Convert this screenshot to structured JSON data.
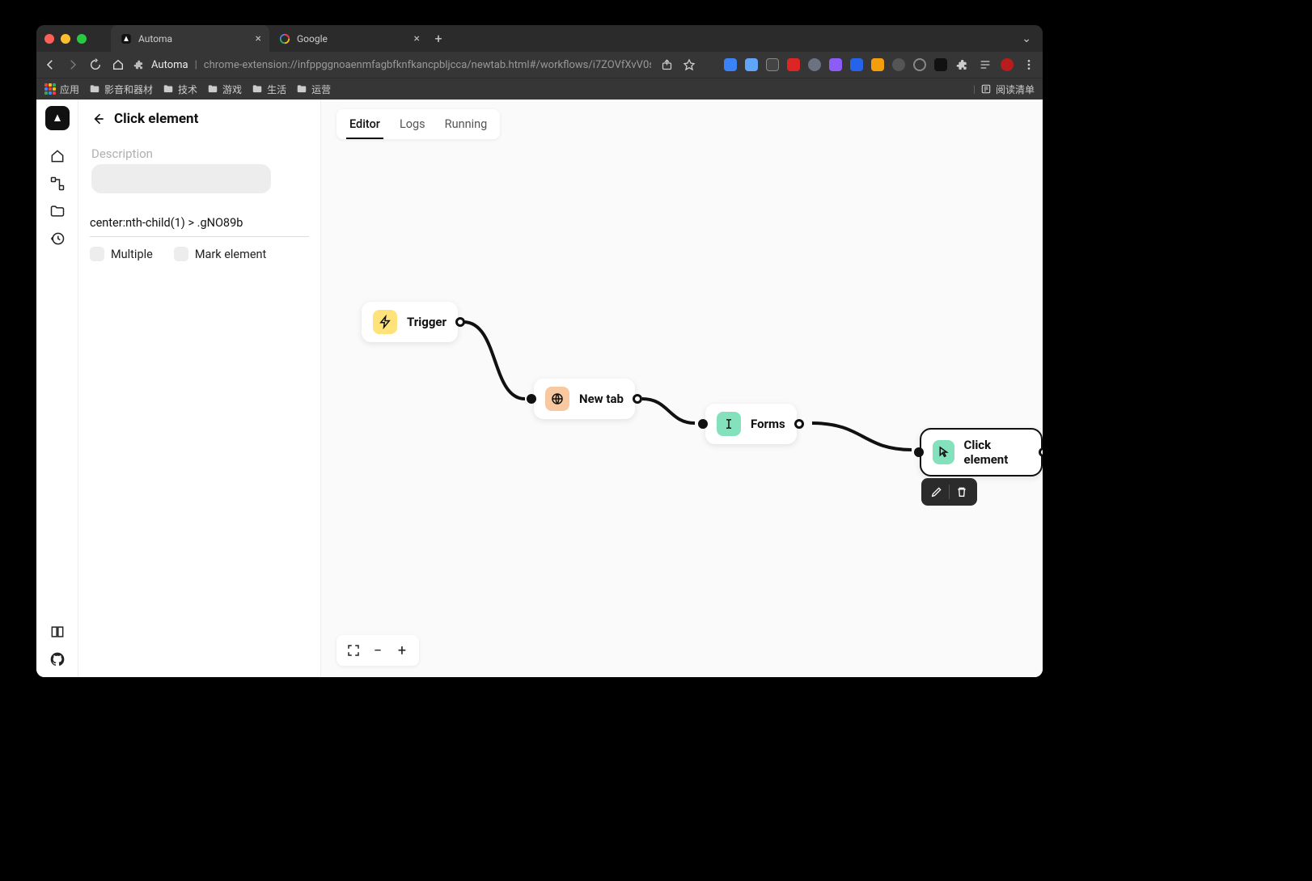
{
  "browser": {
    "tabs": [
      {
        "title": "Automa",
        "active": true
      },
      {
        "title": "Google",
        "active": false
      }
    ],
    "url_host": "Automa",
    "url_path": "chrome-extension://infppggnoaenmfagbfknfkancpbljcca/newtab.html#/workflows/i7ZOVfXvV0sNGW...",
    "bookmarks": [
      {
        "label": "应用",
        "type": "apps"
      },
      {
        "label": "影音和器材",
        "type": "folder"
      },
      {
        "label": "技术",
        "type": "folder"
      },
      {
        "label": "游戏",
        "type": "folder"
      },
      {
        "label": "生活",
        "type": "folder"
      },
      {
        "label": "运营",
        "type": "folder"
      }
    ],
    "reading_list": "阅读清单"
  },
  "panel": {
    "title": "Click element",
    "description_label": "Description",
    "description_value": "",
    "selector_value": "center:nth-child(1) > .gNO89b",
    "multiple_label": "Multiple",
    "mark_label": "Mark element"
  },
  "editor_tabs": {
    "editor": "Editor",
    "logs": "Logs",
    "running": "Running"
  },
  "nodes": {
    "trigger": "Trigger",
    "newtab": "New tab",
    "forms": "Forms",
    "click": "Click element"
  }
}
